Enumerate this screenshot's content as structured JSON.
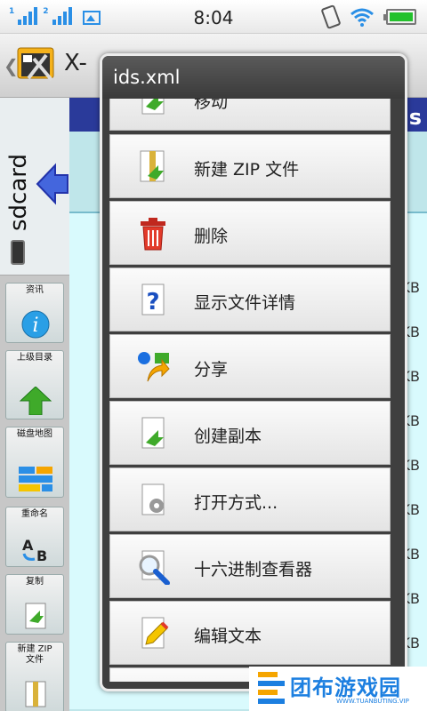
{
  "status_bar": {
    "sim1_tag": "1",
    "sim2_tag": "2",
    "time": "8:04",
    "battery_color": "#23c12c"
  },
  "app": {
    "title": "X-"
  },
  "sidebar": {
    "sdcard_label": "sdcard",
    "buttons": [
      {
        "label": "资讯",
        "icon": "info-icon"
      },
      {
        "label": "上级目录",
        "icon": "up-arrow-icon"
      },
      {
        "label": "磁盘地图",
        "icon": "disk-map-icon"
      },
      {
        "label": "重命名",
        "icon": "rename-icon"
      },
      {
        "label": "复制",
        "icon": "copy-icon"
      },
      {
        "label": "新建 ZIP 文件",
        "icon": "zip-icon"
      }
    ]
  },
  "content": {
    "strip_letter": "s",
    "size_suffix": "KB"
  },
  "dialog": {
    "title": "ids.xml",
    "items": [
      {
        "label": "移动",
        "icon": "move-icon"
      },
      {
        "label": "新建 ZIP 文件",
        "icon": "zip-icon"
      },
      {
        "label": "删除",
        "icon": "trash-icon"
      },
      {
        "label": "显示文件详情",
        "icon": "question-icon"
      },
      {
        "label": "分享",
        "icon": "share-icon"
      },
      {
        "label": "创建副本",
        "icon": "copy-icon"
      },
      {
        "label": "打开方式...",
        "icon": "gear-file-icon"
      },
      {
        "label": "十六进制查看器",
        "icon": "hex-magnifier-icon"
      },
      {
        "label": "编辑文本",
        "icon": "edit-pencil-icon"
      }
    ]
  },
  "watermark": {
    "text": "团布游戏园",
    "sub": "WWW.TUANBUTING.VIP"
  }
}
